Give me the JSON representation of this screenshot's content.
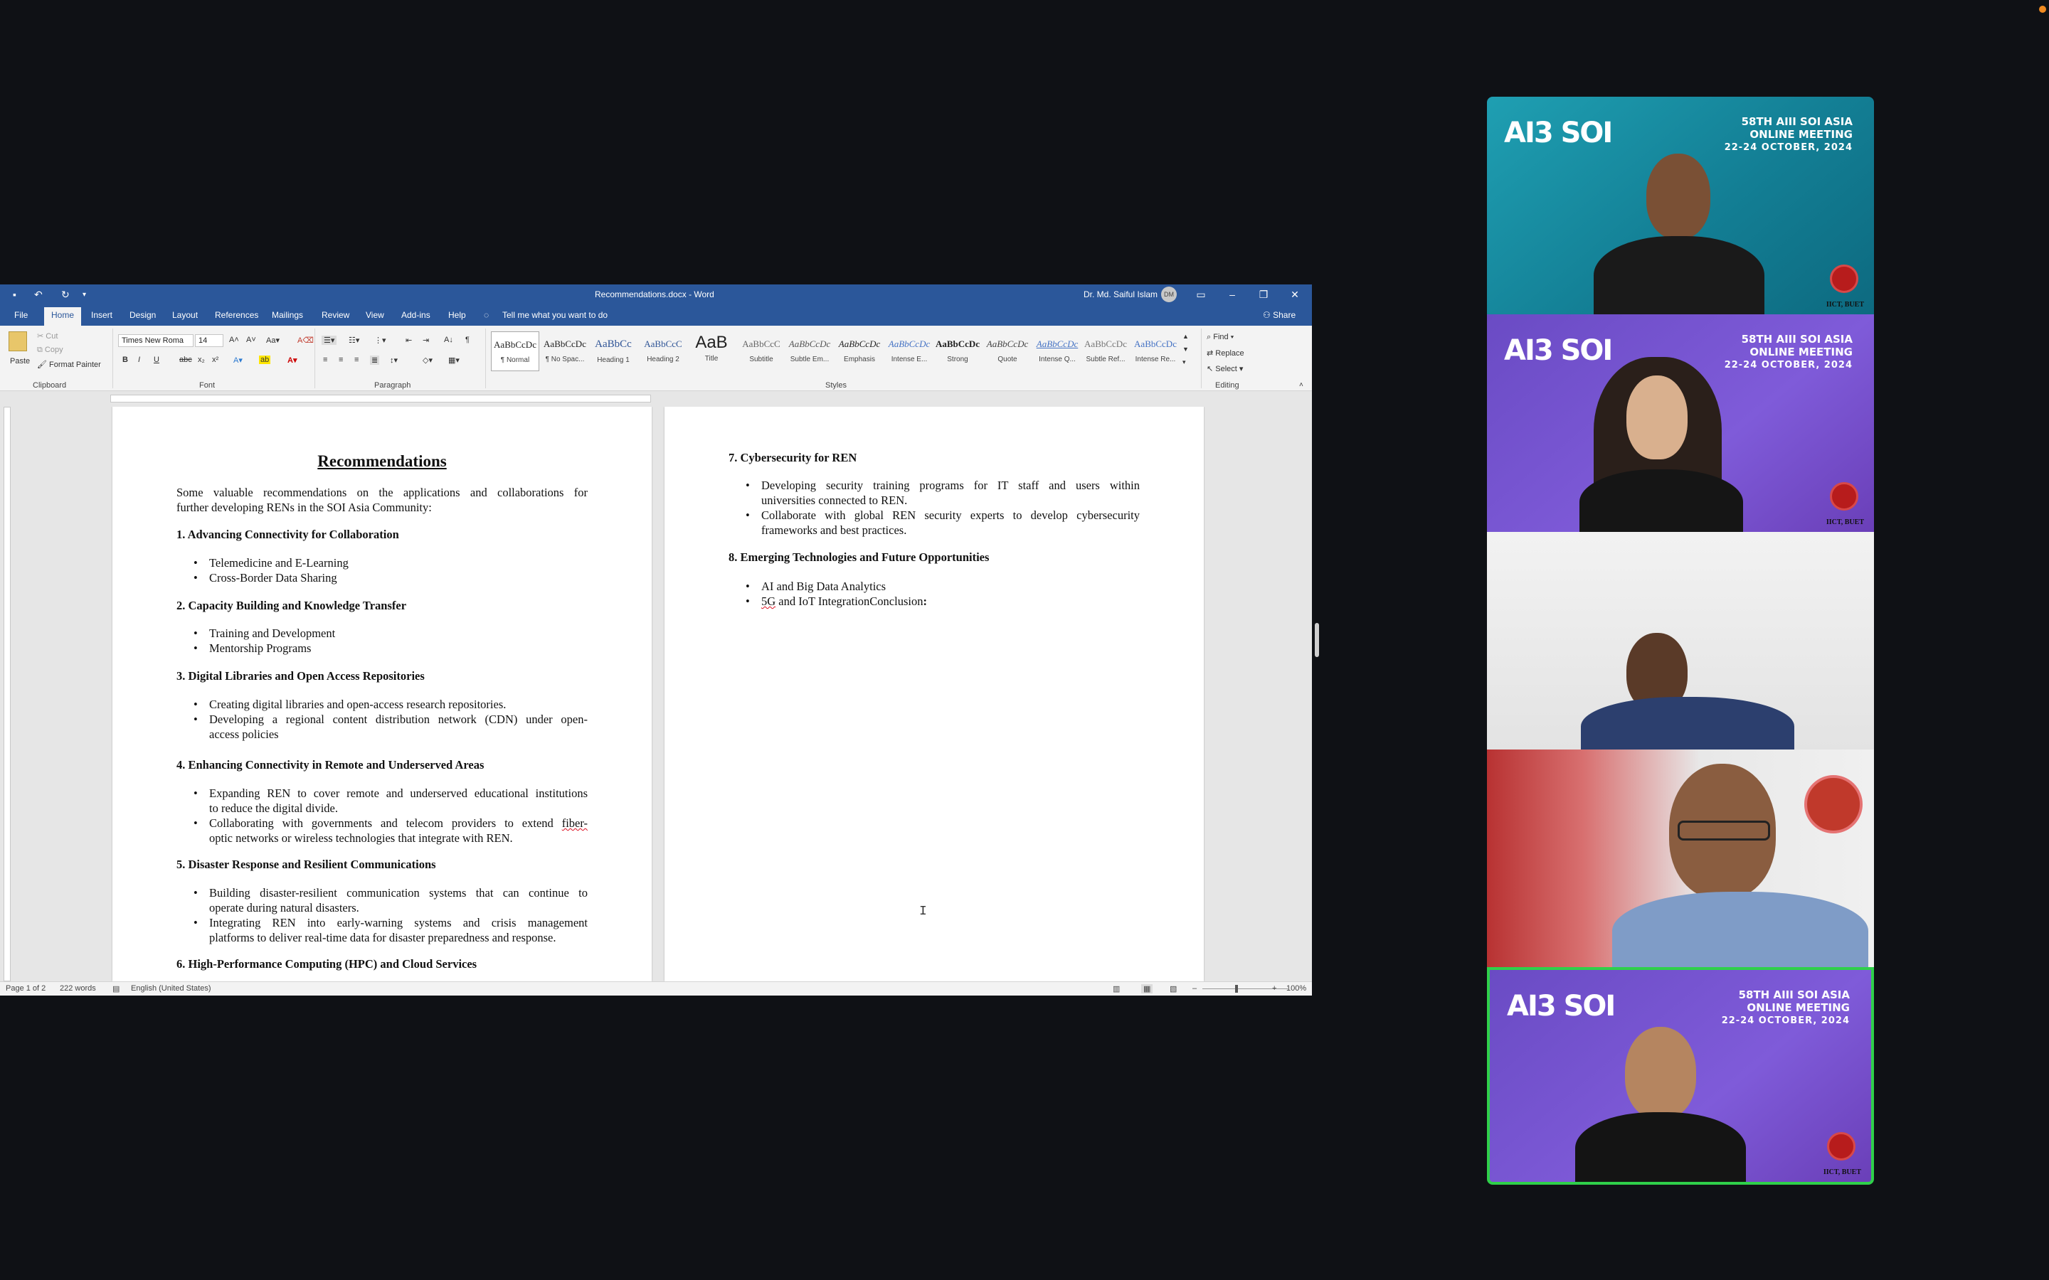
{
  "word": {
    "title_bar": {
      "document_title": "Recommendations.docx - Word",
      "user_name": "Dr. Md. Saiful Islam",
      "user_initials": "DM"
    },
    "tabs": [
      "File",
      "Home",
      "Insert",
      "Design",
      "Layout",
      "References",
      "Mailings",
      "Review",
      "View",
      "Add-ins",
      "Help"
    ],
    "tell_me": "Tell me what you want to do",
    "share": "Share",
    "ribbon": {
      "clipboard": {
        "paste": "Paste",
        "cut": "Cut",
        "copy": "Copy",
        "format_painter": "Format Painter",
        "label": "Clipboard"
      },
      "font": {
        "family": "Times New Roma",
        "size": "14",
        "label": "Font"
      },
      "paragraph": {
        "label": "Paragraph"
      },
      "styles": {
        "label": "Styles",
        "items": [
          {
            "preview": "AaBbCcDc",
            "name": "¶ Normal"
          },
          {
            "preview": "AaBbCcDc",
            "name": "¶ No Spac..."
          },
          {
            "preview": "AaBbCc",
            "name": "Heading 1"
          },
          {
            "preview": "AaBbCcC",
            "name": "Heading 2"
          },
          {
            "preview": "AaB",
            "name": "Title"
          },
          {
            "preview": "AaBbCcC",
            "name": "Subtitle"
          },
          {
            "preview": "AaBbCcDc",
            "name": "Subtle Em..."
          },
          {
            "preview": "AaBbCcDc",
            "name": "Emphasis"
          },
          {
            "preview": "AaBbCcDc",
            "name": "Intense E..."
          },
          {
            "preview": "AaBbCcDc",
            "name": "Strong"
          },
          {
            "preview": "AaBbCcDc",
            "name": "Quote"
          },
          {
            "preview": "AaBbCcDc",
            "name": "Intense Q..."
          },
          {
            "preview": "AaBbCcDc",
            "name": "Subtle Ref..."
          },
          {
            "preview": "AaBbCcDc",
            "name": "Intense Re..."
          }
        ]
      },
      "editing": {
        "find": "Find",
        "replace": "Replace",
        "select": "Select",
        "label": "Editing"
      }
    },
    "page1": {
      "title": "Recommendations",
      "intro_line1": "Some valuable recommendations on the applications and collaborations for",
      "intro_line2": "further developing RENs in the SOI Asia Community:",
      "s1": {
        "heading": "1. Advancing Connectivity for Collaboration",
        "b1": "Telemedicine and E-Learning",
        "b2": "Cross-Border Data Sharing"
      },
      "s2": {
        "heading": "2. Capacity Building and Knowledge Transfer",
        "b1": "Training and Development",
        "b2": "Mentorship Programs"
      },
      "s3": {
        "heading": "3.  Digital Libraries and Open Access Repositories",
        "b1": "Creating digital libraries and open-access research repositories.",
        "b2_l1": "Developing a regional content distribution network (CDN) under open-",
        "b2_l2": "access policies"
      },
      "s4": {
        "heading": "4. Enhancing Connectivity in Remote and Underserved Areas",
        "b1_l1": "Expanding REN to cover remote and underserved educational institutions",
        "b1_l2": "to reduce the digital divide.",
        "b2_l1": "Collaborating with governments and telecom providers to extend",
        "b2_spell": "fiber-",
        "b2_l2": "optic networks or wireless technologies that integrate with REN."
      },
      "s5": {
        "heading": "5. Disaster Response and Resilient Communications",
        "b1_l1": "Building disaster-resilient communication systems that can continue to",
        "b1_l2": "operate during natural disasters.",
        "b2_l1": "Integrating REN into early-warning systems and crisis management",
        "b2_l2": "platforms to deliver real-time data for disaster preparedness and response."
      },
      "s6": {
        "heading": "6. High-Performance Computing (HPC) and Cloud Services"
      }
    },
    "page2": {
      "s7": {
        "heading": "7.  Cybersecurity for REN",
        "b1_l1": "Developing security training programs for IT staff and users within",
        "b1_l2": "universities connected to REN.",
        "b2_l1": "Collaborate with global REN security experts to develop cybersecurity",
        "b2_l2": "frameworks and best practices."
      },
      "s8": {
        "heading": "8.  Emerging Technologies and Future Opportunities",
        "b1": "AI and Big Data Analytics",
        "b2_spell": "5G",
        "b2_rest": " and IoT IntegrationConclusion",
        "b2_bold": ":"
      }
    },
    "status_bar": {
      "page": "Page 1 of 2",
      "words": "222 words",
      "language": "English (United States)",
      "zoom": "100%"
    }
  },
  "video_tiles": {
    "banner": {
      "logo": "AI3 SOI",
      "event_line1": "58TH AIII SOI ASIA",
      "event_line2": "ONLINE MEETING",
      "event_dates": "22-24 OCTOBER, 2024",
      "org": "IICT, BUET"
    }
  },
  "colors": {
    "word_blue": "#2b579a",
    "active_speaker": "#2fd04a",
    "tile_teal": "#1f9fb2",
    "tile_purple": "#7f5bd9"
  }
}
